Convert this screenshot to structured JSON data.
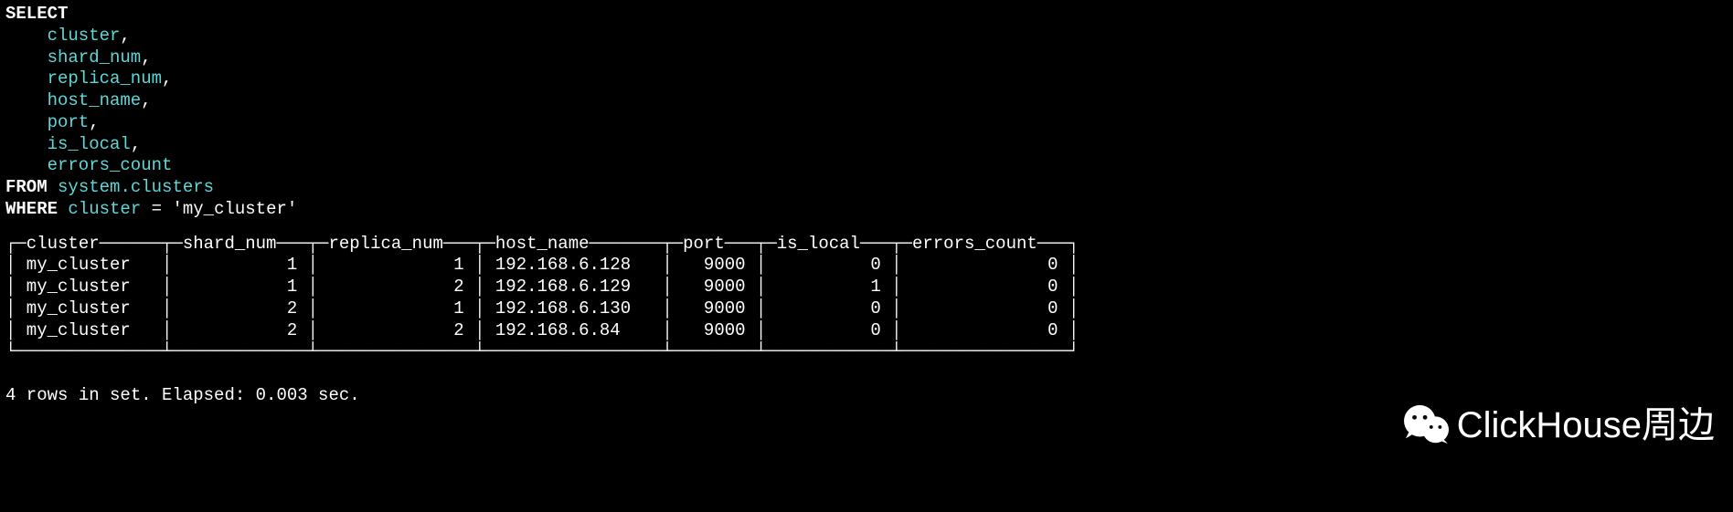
{
  "sql": {
    "select_kw": "SELECT",
    "columns": [
      "cluster",
      "shard_num",
      "replica_num",
      "host_name",
      "port",
      "is_local",
      "errors_count"
    ],
    "from_kw": "FROM",
    "from_schema": "system",
    "from_table": "clusters",
    "where_kw": "WHERE",
    "where_col": "cluster",
    "where_op": "=",
    "where_val": "'my_cluster'"
  },
  "table": {
    "headers": [
      "cluster",
      "shard_num",
      "replica_num",
      "host_name",
      "port",
      "is_local",
      "errors_count"
    ],
    "rows": [
      {
        "cluster": "my_cluster",
        "shard_num": "1",
        "replica_num": "1",
        "host_name": "192.168.6.128",
        "port": "9000",
        "is_local": "0",
        "errors_count": "0"
      },
      {
        "cluster": "my_cluster",
        "shard_num": "1",
        "replica_num": "2",
        "host_name": "192.168.6.129",
        "port": "9000",
        "is_local": "1",
        "errors_count": "0"
      },
      {
        "cluster": "my_cluster",
        "shard_num": "2",
        "replica_num": "1",
        "host_name": "192.168.6.130",
        "port": "9000",
        "is_local": "0",
        "errors_count": "0"
      },
      {
        "cluster": "my_cluster",
        "shard_num": "2",
        "replica_num": "2",
        "host_name": "192.168.6.84",
        "port": "9000",
        "is_local": "0",
        "errors_count": "0"
      }
    ]
  },
  "status": "4 rows in set. Elapsed: 0.003 sec.",
  "watermark": "ClickHouse周边",
  "col_widths": {
    "cluster": 12,
    "shard_num": 11,
    "replica_num": 13,
    "host_name": 15,
    "port": 6,
    "is_local": 10,
    "errors_count": 14
  }
}
